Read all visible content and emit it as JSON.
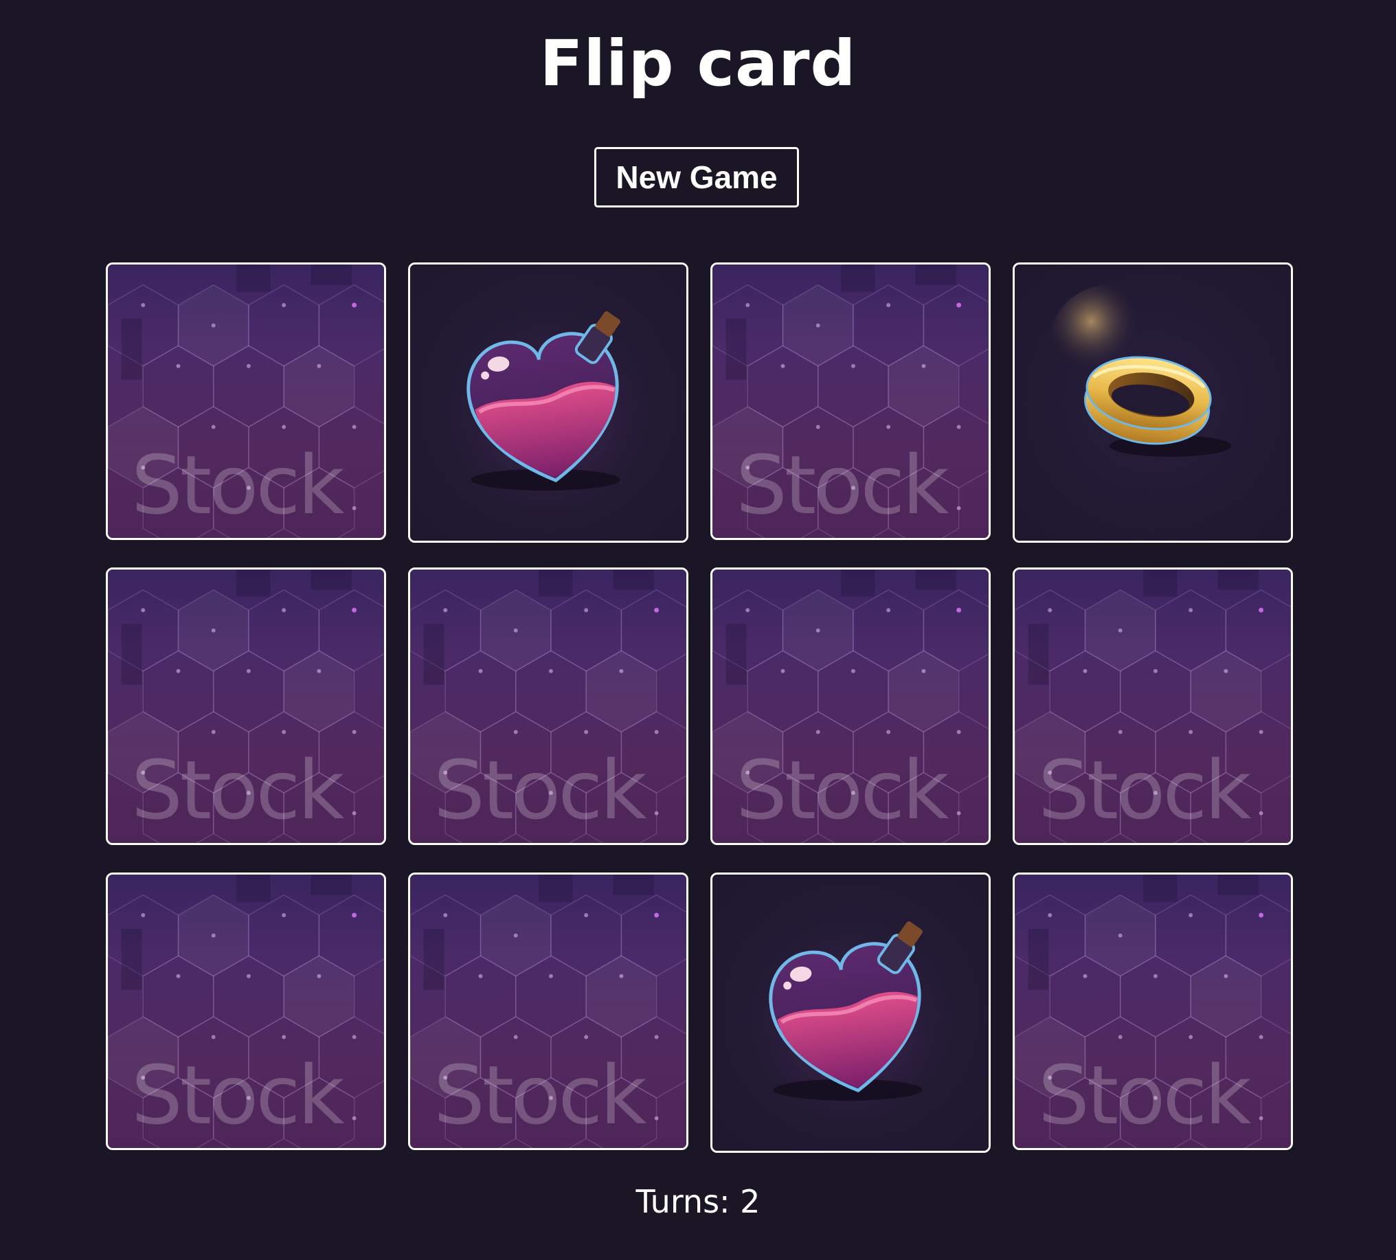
{
  "header": {
    "title": "Flip card",
    "new_game_label": "New Game"
  },
  "board": {
    "columns": 4,
    "rows": 3,
    "back_watermark": "Stock",
    "cards": [
      {
        "state": "face-down",
        "item": null
      },
      {
        "state": "face-up",
        "item": "heart-potion"
      },
      {
        "state": "face-down",
        "item": null
      },
      {
        "state": "face-up",
        "item": "gold-ring"
      },
      {
        "state": "face-down",
        "item": null
      },
      {
        "state": "face-down",
        "item": null
      },
      {
        "state": "face-down",
        "item": null
      },
      {
        "state": "face-down",
        "item": null
      },
      {
        "state": "face-down",
        "item": null
      },
      {
        "state": "face-down",
        "item": null
      },
      {
        "state": "face-up",
        "item": "heart-potion"
      },
      {
        "state": "face-down",
        "item": null
      }
    ]
  },
  "footer": {
    "turns_label": "Turns:",
    "turns_value": "2"
  },
  "colors": {
    "background": "#1b1626",
    "text": "#ffffff",
    "card_back": "#4a2a68",
    "card_front": "#221a33",
    "potion_liquid": "#c0306f",
    "ring_gold": "#e8b84a"
  }
}
